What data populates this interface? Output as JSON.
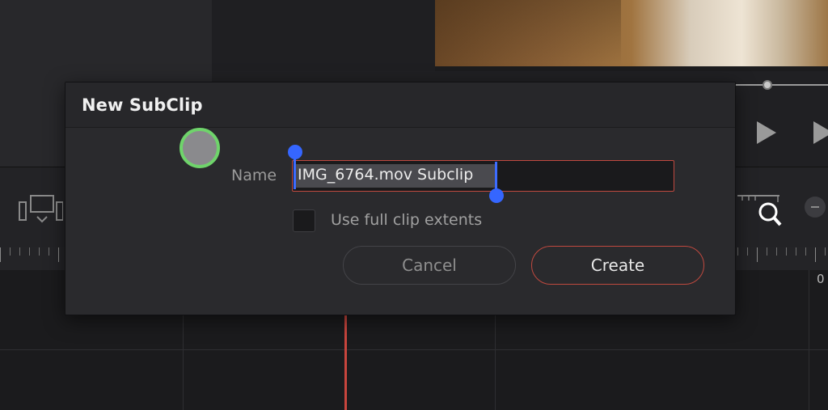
{
  "dialog": {
    "title": "New SubClip",
    "name_label": "Name",
    "name_value": "IMG_6764.mov Subclip",
    "checkbox_label": "Use full clip extents",
    "checkbox_checked": false,
    "cancel_label": "Cancel",
    "create_label": "Create"
  },
  "timeline": {
    "ruler_label": "0"
  },
  "colors": {
    "accent": "#c0493f",
    "selection_handle": "#3566ff",
    "touch_ring": "#6fd46b",
    "playhead": "#c8453d"
  },
  "icons": [
    "play-icon",
    "next-frame-icon",
    "monitor-icon",
    "zoom-icon",
    "minus-icon"
  ]
}
